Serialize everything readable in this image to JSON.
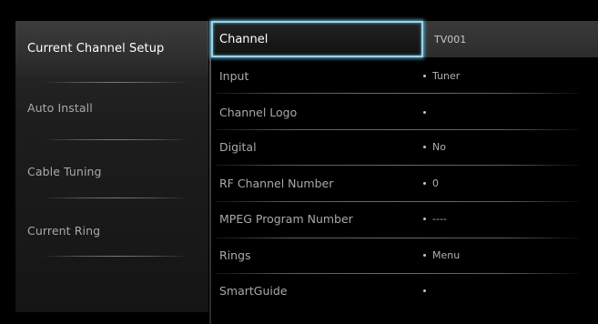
{
  "left_menu": {
    "items": [
      {
        "label": "Current Channel Setup",
        "active": true
      },
      {
        "label": "Auto Install",
        "active": false
      },
      {
        "label": "Cable Tuning",
        "active": false
      },
      {
        "label": "Current Ring",
        "active": false
      }
    ]
  },
  "settings": {
    "channel": {
      "label": "Channel",
      "value": "TV001"
    },
    "rows": [
      {
        "label": "Input",
        "value": "Tuner"
      },
      {
        "label": "Channel Logo",
        "value": ""
      },
      {
        "label": "Digital",
        "value": "No"
      },
      {
        "label": "RF Channel Number",
        "value": "0"
      },
      {
        "label": "MPEG Program Number",
        "value": "----"
      },
      {
        "label": "Rings",
        "value": "Menu"
      },
      {
        "label": "SmartGuide",
        "value": ""
      }
    ]
  },
  "colors": {
    "focus_border": "#9fd3ea",
    "active_bg": "#3c3c3c",
    "text_primary": "#ffffff",
    "text_secondary": "#a9a9a9"
  }
}
